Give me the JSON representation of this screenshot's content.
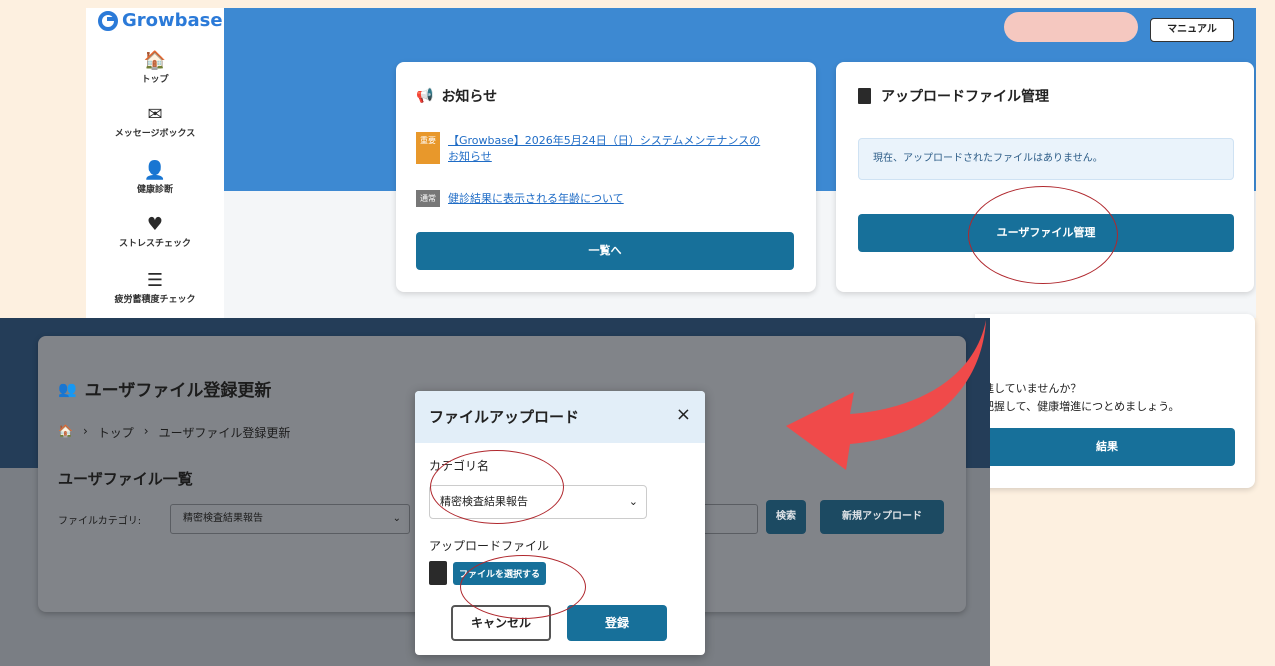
{
  "top": {
    "logo_text": "Growbase",
    "manual_label": "マニュアル",
    "sidebar": [
      {
        "icon": "home-icon",
        "glyph": "🏠",
        "label": "トップ"
      },
      {
        "icon": "envelope-icon",
        "glyph": "✉",
        "label": "メッセージボックス"
      },
      {
        "icon": "doctor-icon",
        "glyph": "👤",
        "label": "健康診断"
      },
      {
        "icon": "heartbeat-icon",
        "glyph": "♥",
        "label": "ストレスチェック"
      },
      {
        "icon": "checklist-icon",
        "glyph": "☰",
        "label": "疲労蓄積度チェック"
      }
    ],
    "news": {
      "title": "お知らせ",
      "items": [
        {
          "badge": "重要",
          "badge_color": "#e8982b",
          "text_line1": "【Growbase】2026年5月24日（日）システムメンテナンスの",
          "text_line2": "お知らせ"
        },
        {
          "badge": "通常",
          "badge_color": "#777777",
          "text_line1": "健診結果に表示される年齢について",
          "text_line2": ""
        }
      ],
      "button": "一覧へ"
    },
    "upload": {
      "title": "アップロードファイル管理",
      "notice": "現在、アップロードされたファイルはありません。",
      "button": "ユーザファイル管理"
    }
  },
  "bottom": {
    "page_title": "ユーザファイル登録更新",
    "breadcrumb": [
      "トップ",
      "ユーザファイル登録更新"
    ],
    "list_title": "ユーザファイル一覧",
    "filter_label": "ファイルカテゴリ:",
    "filter_value": "精密検査結果報告",
    "search_button": "検索",
    "new_upload_button": "新規アップロード",
    "modal": {
      "title": "ファイルアップロード",
      "category_label": "カテゴリ名",
      "category_value": "精密検査結果報告",
      "file_label": "アップロードファイル",
      "choose_button": "ファイルを選択する",
      "cancel_button": "キャンセル",
      "submit_button": "登録"
    }
  },
  "right_card": {
    "line1": "進していませんか？",
    "line2": "把握して、健康増進につとめましょう。",
    "button": "結果"
  },
  "colors": {
    "accent": "#17709a",
    "banner": "#3d89d2",
    "annotation": "#b0282e",
    "arrow": "#f04a4a"
  }
}
